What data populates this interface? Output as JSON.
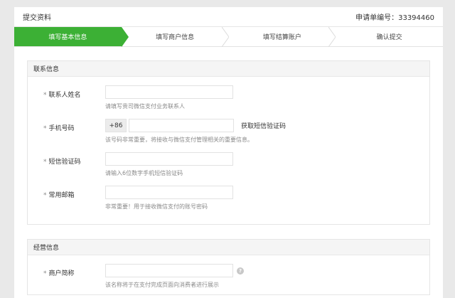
{
  "header": {
    "title": "提交资料",
    "order_label": "申请单编号：33394460"
  },
  "steps": [
    {
      "label": "填写基本信息",
      "active": true
    },
    {
      "label": "填写商户信息",
      "active": false
    },
    {
      "label": "填写结算账户",
      "active": false
    },
    {
      "label": "确认提交",
      "active": false
    }
  ],
  "contact_section": {
    "title": "联系信息",
    "name": {
      "label": "联系人姓名",
      "hint": "请填写贵司微信支付业务联系人"
    },
    "phone": {
      "label": "手机号码",
      "prefix": "+86",
      "button": "获取短信验证码",
      "hint": "该号码非常重要，将接收与微信支付管理相关的重要信息。"
    },
    "sms_code": {
      "label": "短信验证码",
      "hint": "请输入6位数字手机短信验证码"
    },
    "email": {
      "label": "常用邮箱",
      "hint": "非常重要！用于接收微信支付的账号密码"
    }
  },
  "business_section": {
    "title": "经营信息",
    "merchant_short_name": {
      "label": "商户简称",
      "help": "?",
      "hint": "该名称将于在支付完成页面向消费者进行展示"
    }
  },
  "colors": {
    "accent": "#3cb035"
  }
}
